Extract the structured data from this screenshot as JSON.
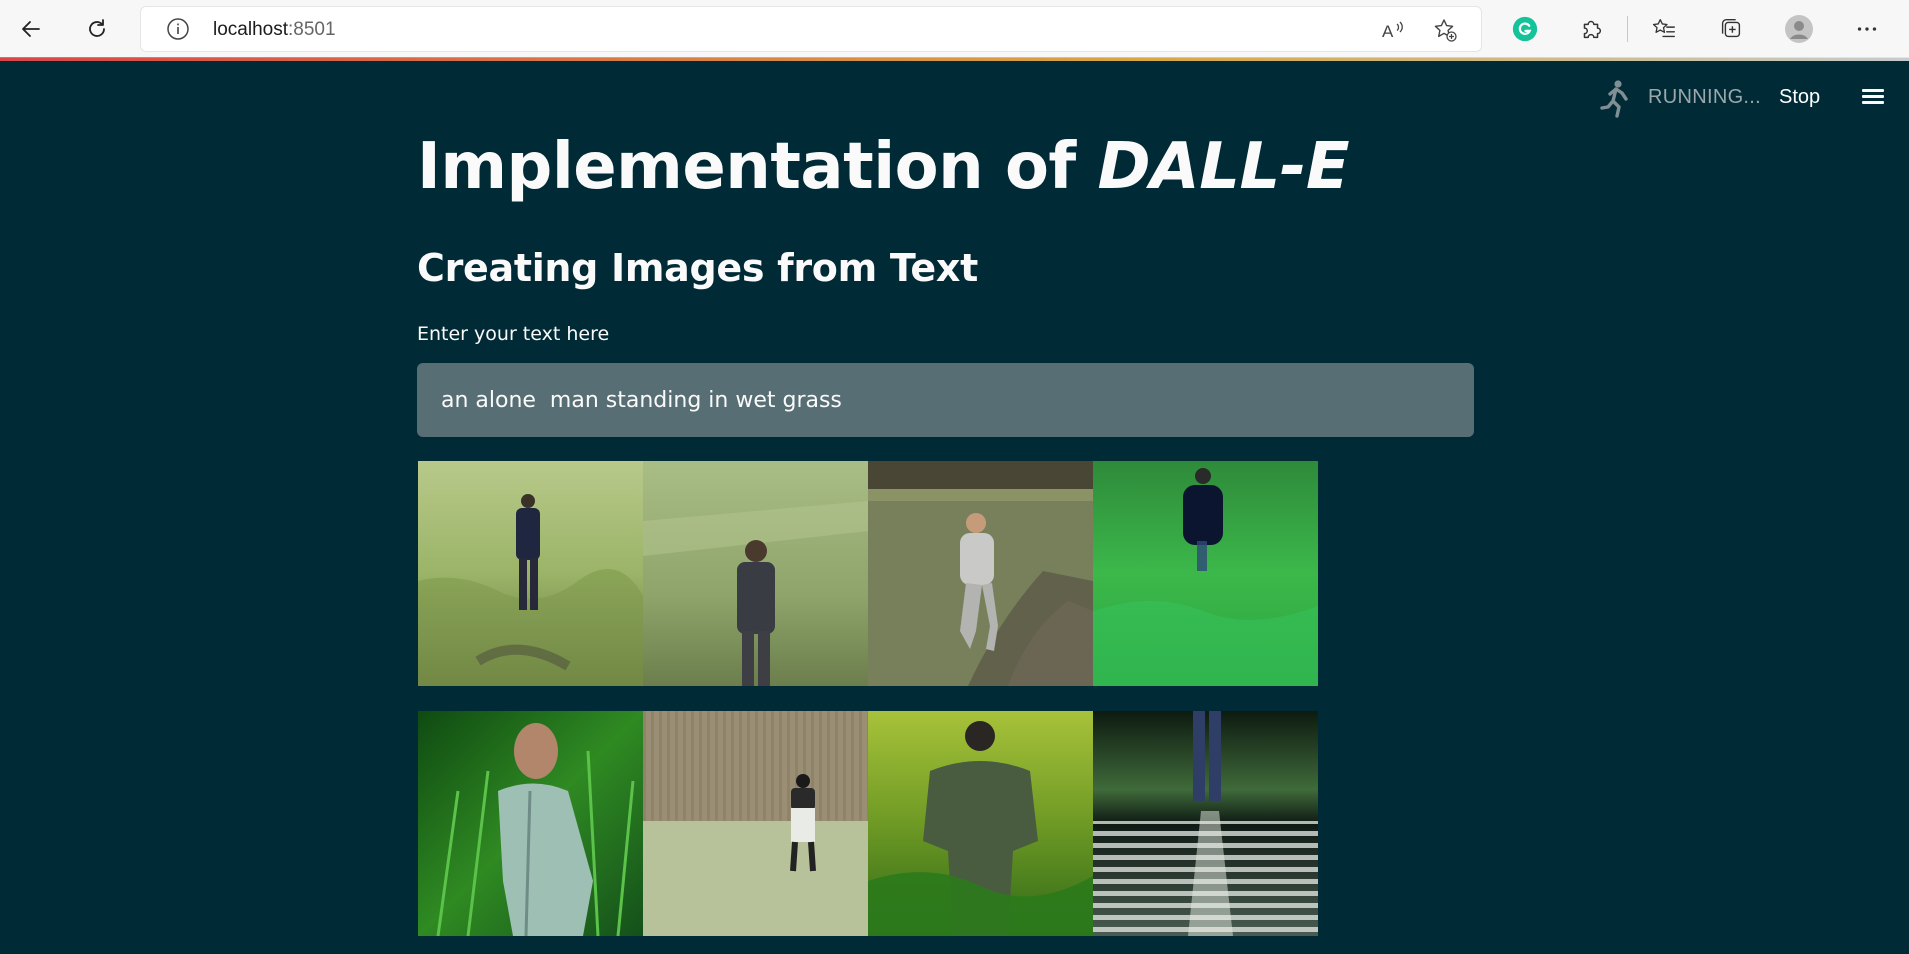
{
  "browser": {
    "url_host": "localhost",
    "url_port": ":8501"
  },
  "app_header": {
    "status": "RUNNING...",
    "stop_label": "Stop"
  },
  "main": {
    "title_plain": "Implementation of ",
    "title_emph": "DALL-E",
    "subtitle": "Creating Images from Text",
    "input_label": "Enter your text here",
    "input_value": "an alone  man standing in wet grass"
  },
  "gallery": {
    "image_count": 8
  },
  "colors": {
    "background": "#002b36",
    "input_bg": "#586e75",
    "text": "#fafafa"
  }
}
